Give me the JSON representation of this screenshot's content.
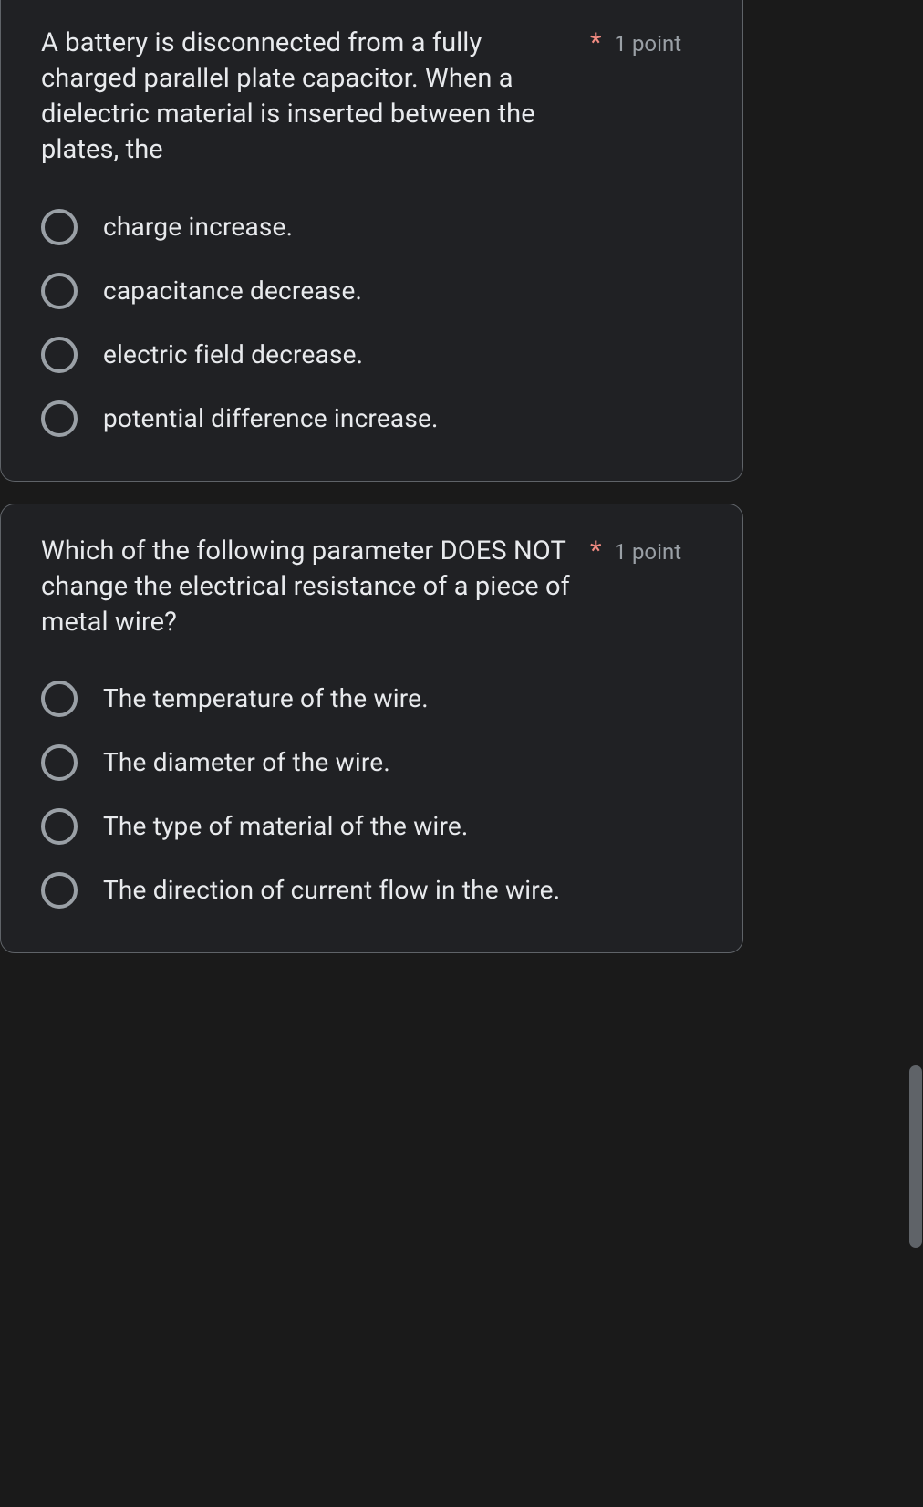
{
  "questions": [
    {
      "text": "A battery is disconnected from a fully charged parallel plate capacitor. When a dielectric material is inserted between the plates, the",
      "required_marker": "*",
      "points": "1 point",
      "options": [
        "charge increase.",
        "capacitance decrease.",
        "electric field decrease.",
        "potential difference increase."
      ]
    },
    {
      "text": "Which of the following parameter DOES NOT change the electrical resistance of a piece of metal wire?",
      "required_marker": "*",
      "points": "1 point",
      "options": [
        "The temperature of the wire.",
        "The diameter of the wire.",
        "The type of material of the wire.",
        "The direction of current flow in the wire."
      ]
    }
  ]
}
